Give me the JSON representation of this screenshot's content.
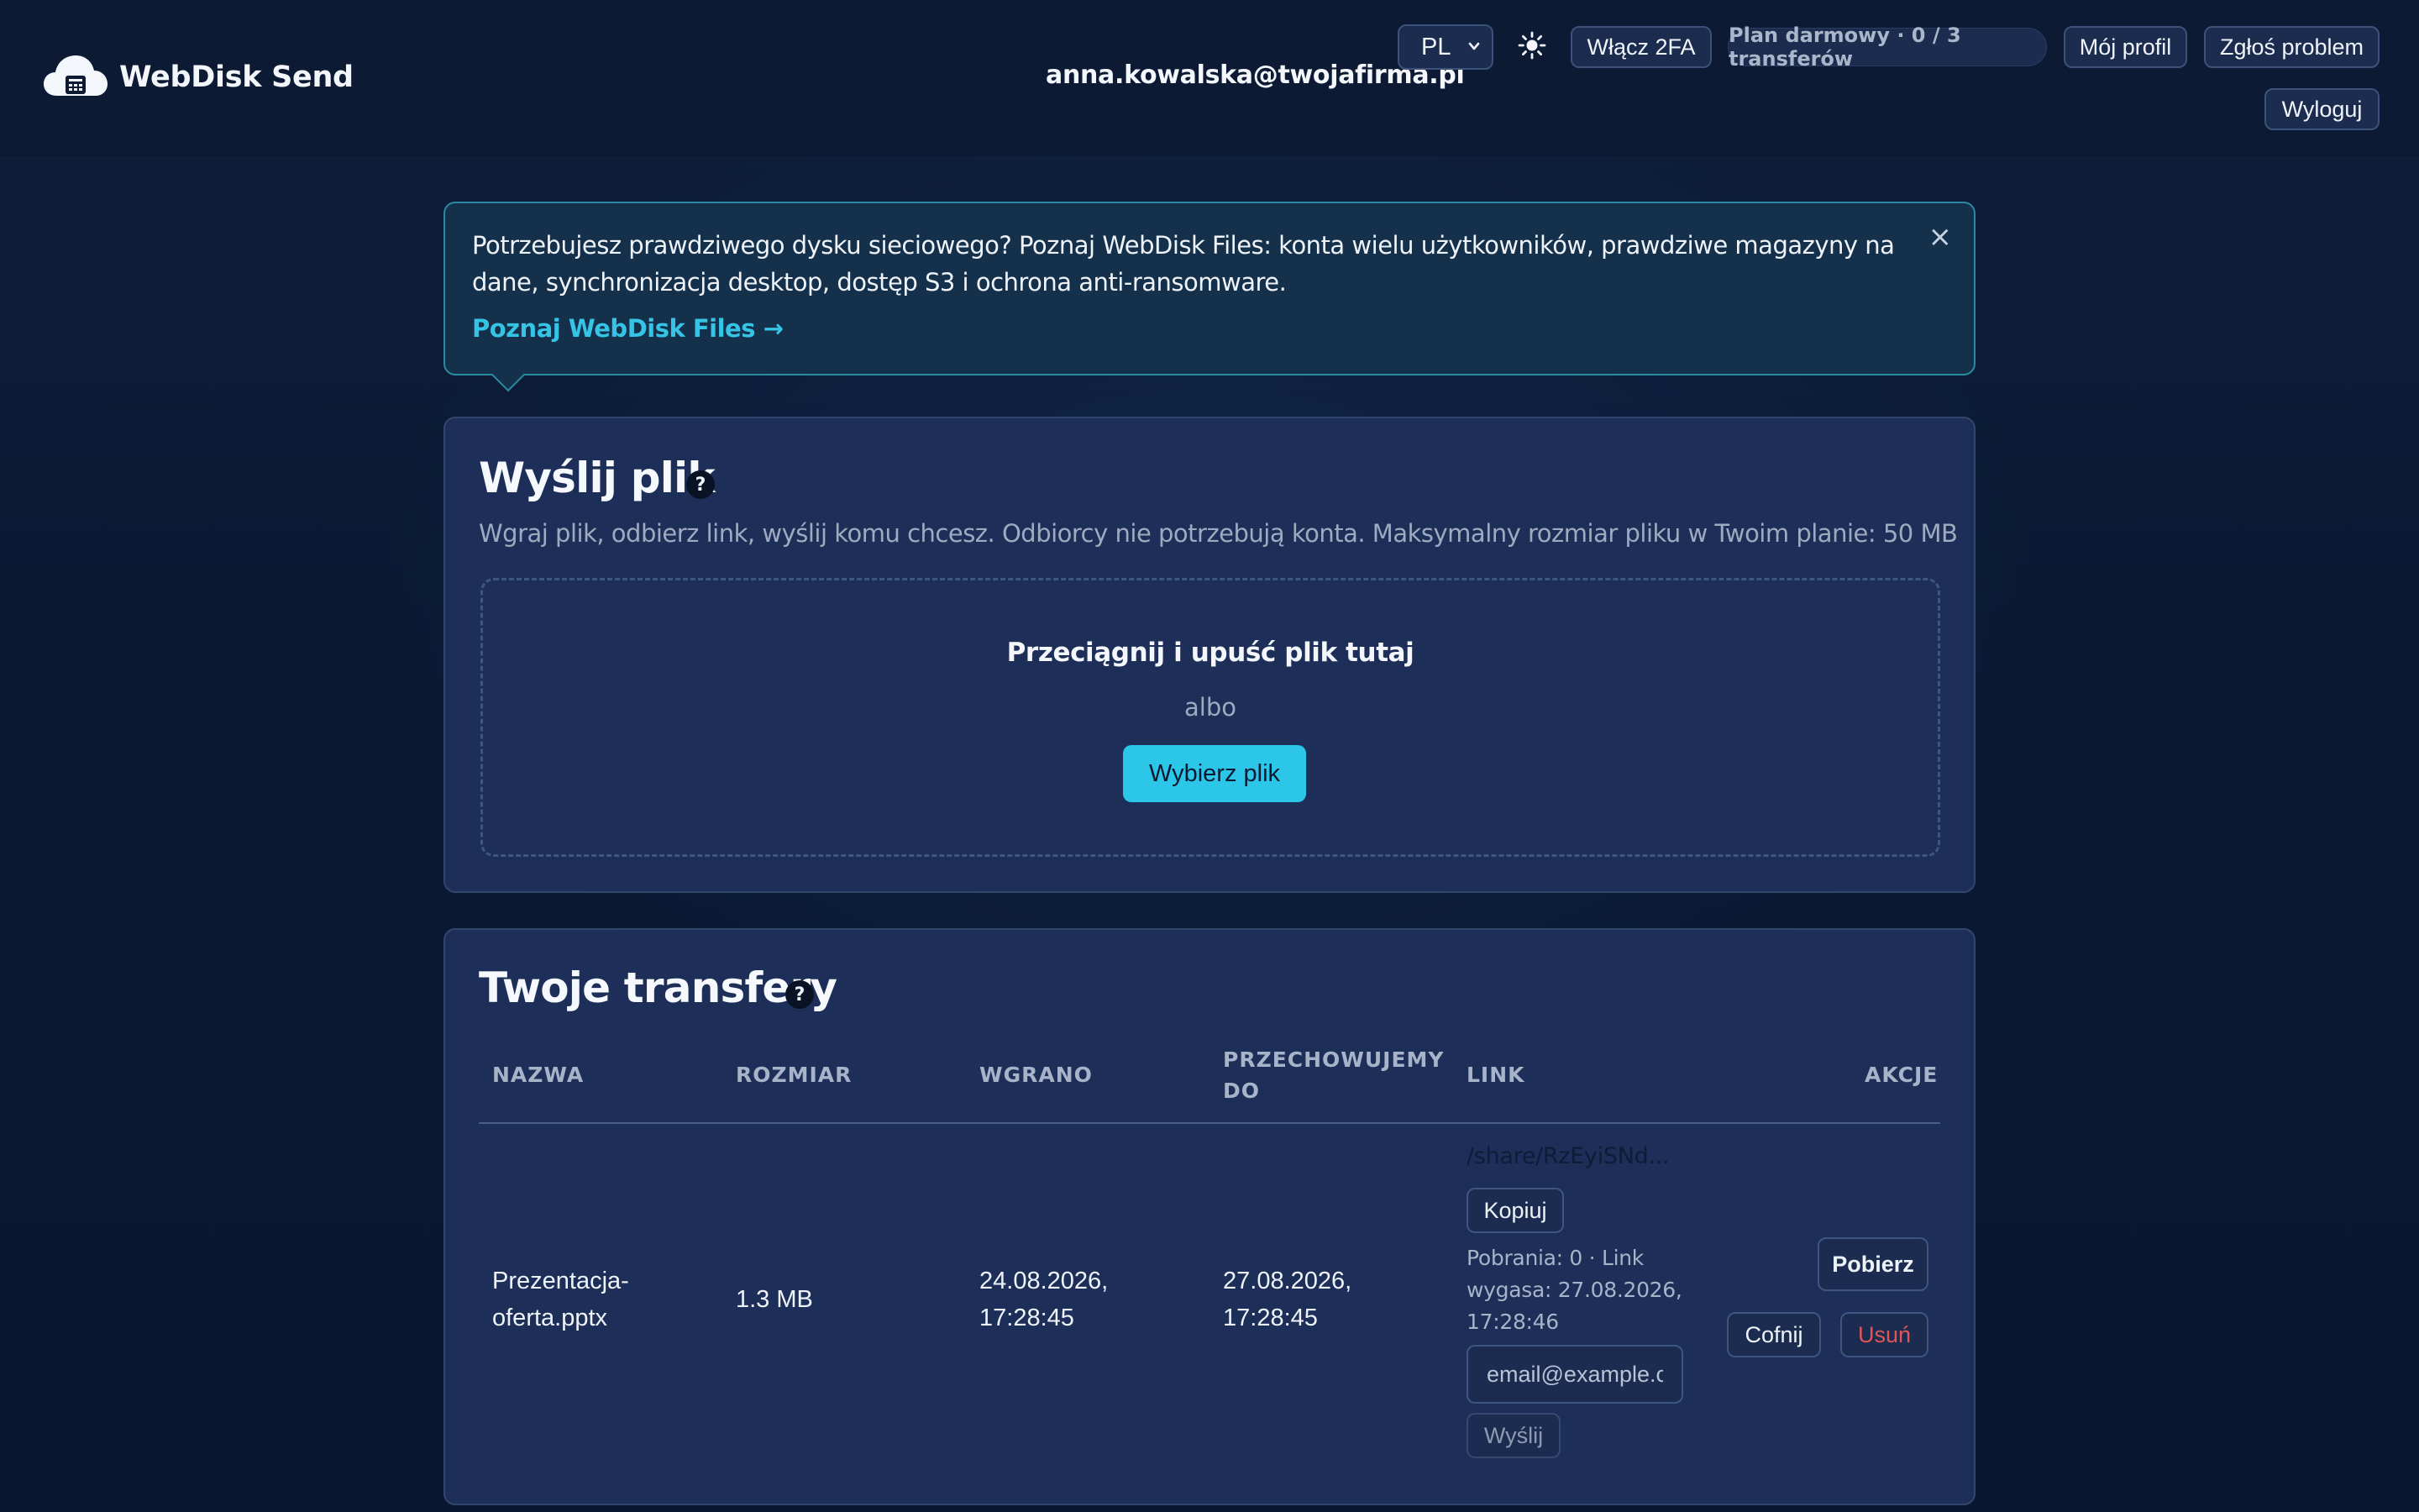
{
  "header": {
    "brand": "WebDisk Send",
    "user_email": "anna.kowalska@twojafirma.pl",
    "language": "PL",
    "theme_icon": "sun-icon",
    "enable_2fa": "Włącz 2FA",
    "plan": "Plan darmowy · 0 / 3 transferów",
    "profile": "Mój profil",
    "report_problem": "Zgłoś problem",
    "logout": "Wyloguj"
  },
  "banner": {
    "text": "Potrzebujesz prawdziwego dysku sieciowego? Poznaj WebDisk Files: konta wielu użytkowników, prawdziwe magazyny na dane, synchronizacja desktop, dostęp S3 i ochrona anti-ransomware.",
    "link": "Poznaj WebDisk Files →",
    "close": "×"
  },
  "upload": {
    "title": "Wyślij plik",
    "help": "?",
    "description": "Wgraj plik, odbierz link, wyślij komu chcesz. Odbiorcy nie potrzebują konta. Maksymalny rozmiar pliku w Twoim planie: 50 MB",
    "drop_title": "Przeciągnij i upuść plik tutaj",
    "or": "albo",
    "choose_file": "Wybierz plik"
  },
  "transfers": {
    "title": "Twoje transfery",
    "help": "?",
    "columns": {
      "name": "NAZWA",
      "size": "ROZMIAR",
      "uploaded": "WGRANO",
      "stored_until_1": "PRZECHOWUJEMY",
      "stored_until_2": "DO",
      "link": "LINK",
      "actions": "AKCJE"
    },
    "rows": [
      {
        "name_1": "Prezentacja-",
        "name_2": "oferta.pptx",
        "size": "1.3 MB",
        "uploaded_1": "24.08.2026,",
        "uploaded_2": "17:28:45",
        "stored_1": "27.08.2026,",
        "stored_2": "17:28:45",
        "link": "/share/RzEyiSNd...",
        "copy": "Kopiuj",
        "meta_1": "Pobrania: 0 · Link",
        "meta_2": "wygasa: 27.08.2026,",
        "meta_3": "17:28:46",
        "email_placeholder": "email@example.com",
        "send": "Wyślij",
        "download": "Pobierz",
        "revoke": "Cofnij",
        "delete": "Usuń"
      }
    ]
  }
}
